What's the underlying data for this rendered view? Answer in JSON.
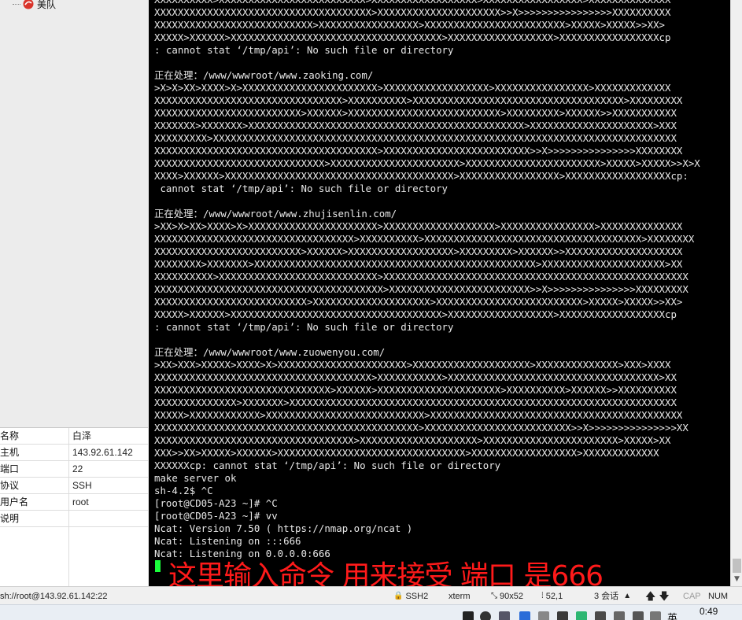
{
  "sidebar": {
    "tree_item_label": "美队",
    "properties": [
      {
        "key": "名称",
        "value": "白泽"
      },
      {
        "key": "主机",
        "value": "143.92.61.142"
      },
      {
        "key": "端口",
        "value": "22"
      },
      {
        "key": "协议",
        "value": "SSH"
      },
      {
        "key": "用户名",
        "value": "root"
      },
      {
        "key": "说明",
        "value": ""
      }
    ]
  },
  "terminal": {
    "lines": [
      "XXXXXXXXXX>XXXXXXXXXXXXXXXXXXXXXXXXX>XXXXXXXXXXXXXXXXXX>XXXXXXXXXXXXXXXXX>XXXXXXXXXXXXXX",
      "XXXXXXXXXXXXXXXXXXXXXXXXXXXXXXXXXXXXX>XXXXXXXXXXXXXXXXXXXXX>>X>>>>>>>>>>>>>>>>XXXXXXXXXX",
      "XXXXXXXXXXXXXXXXXXXXXXXXXXX>XXXXXXXXXXXXXXXXX>XXXXXXXXXXXXXXXXXXXXXXXX>XXXXX>XXXXX>>XX>",
      "XXXXX>XXXXXX>XXXXXXXXXXXXXXXXXXXXXXXXXXXXXXXXXXXX>XXXXXXXXXXXXXXXXXX>XXXXXXXXXXXXXXXXXcp",
      ": cannot stat ‘/tmp/api’: No such file or directory",
      "",
      "正在处理：/www/wwwroot/www.zaoking.com/",
      ">X>X>XX>XXXX>X>XXXXXXXXXXXXXXXXXXXXXXX>XXXXXXXXXXXXXXXXXX>XXXXXXXXXXXXXXXX>XXXXXXXXXXXXX",
      "XXXXXXXXXXXXXXXXXXXXXXXXXXXXXXXX>XXXXXXXXXX>XXXXXXXXXXXXXXXXXXXXXXXXXXXXXXXXXXXX>XXXXXXXXX",
      "XXXXXXXXXXXXXXXXXXXXXXXXX>XXXXXX>XXXXXXXXXXXXXXXXXXXXXXXXXX>XXXXXXXXX>XXXXXX>>XXXXXXXXXXX",
      "XXXXXXX>XXXXXXX>XXXXXXXXXXXXXXXXXXXXXXXXXXXXXXXXXXXXXXXXXXXXXXX>XXXXXXXXXXXXXXXXXXXXX>XXX",
      "XXXXXXXXX>XXXXXXXXXXXXXXXXXXXXXXXXXXXXXXXXXXXXXXXXXXXXXXXXXXXXXXXXXXXXXXXXXXXXXXXXXXXXXXX",
      "XXXXXXXXXXXXXXXXXXXXXXXXXXXXXXXXXXXXXX>XXXXXXXXXXXXXXXXXXXXXXXXX>>X>>>>>>>>>>>>>>>XXXXXXXX",
      "XXXXXXXXXXXXXXXXXXXXXXXXXXXXX>XXXXXXXXXXXXXXXXXXXXXX>XXXXXXXXXXXXXXXXXXXXXXX>XXXXX>XXXXX>>X>X",
      "XXXX>XXXXXX>XXXXXXXXXXXXXXXXXXXXXXXXXXXXXXXXXXXXXXX>XXXXXXXXXXXXXXXXX>XXXXXXXXXXXXXXXXXXcp:",
      " cannot stat ‘/tmp/api’: No such file or directory",
      "",
      "正在处理：/www/wwwroot/www.zhujisenlin.com/",
      ">XX>X>XX>XXXX>X>XXXXXXXXXXXXXXXXXXXXXX>XXXXXXXXXXXXXXXXXXX>XXXXXXXXXXXXXXXX>XXXXXXXXXXXXXX",
      "XXXXXXXXXXXXXXXXXXXXXXXXXXXXXXXXXX>XXXXXXXXXX>XXXXXXXXXXXXXXXXXXXXXXXXXXXXXXXXXXXXX>XXXXXXXX",
      "XXXXXXXXXXXXXXXXXXXXXXXXX>XXXXXX>XXXXXXXXXXXXXXXXXX>XXXXXXXXX>XXXXXX>>XXXXXXXXXXXXXXXXXXXX",
      "XXXXXXXX>XXXXXXX>XXXXXXXXXXXXXXXXXXXXXXXXXXXXXXXXXXXXXXXXXXXXXXXX>XXXXXXXXXXXXXXXXXXXXX>XX",
      "XXXXXXXXXX>XXXXXXXXXXXXXXXXXXXXXXXXXXX>XXXXXXXXXXXXXXXXXXXXXXXXXXXXXXXXXXXXXXXXXXXXXXXXXXXX",
      "XXXXXXXXXXXXXXXXXXXXXXXXXXXXXXXXXXXXXXX>XXXXXXXXXXXXXXXXXXXXXXXX>>X>>>>>>>>>>>>>>>XXXXXXXXX",
      "XXXXXXXXXXXXXXXXXXXXXXXXXX>XXXXXXXXXXXXXXXXXXXX>XXXXXXXXXXXXXXXXXXXXXXXXX>XXXXX>XXXXX>>XX>",
      "XXXXX>XXXXXX>XXXXXXXXXXXXXXXXXXXXXXXXXXXXXXXXXXXX>XXXXXXXXXXXXXXXXXX>XXXXXXXXXXXXXXXXXXcp",
      ": cannot stat ‘/tmp/api’: No such file or directory",
      "",
      "正在处理：/www/wwwroot/www.zuowenyou.com/",
      ">XX>XXX>XXXXX>XXXX>X>XXXXXXXXXXXXXXXXXXXXXX>XXXXXXXXXXXXXXXXXXXX>XXXXXXXXXXXXXX>XXX>XXXX",
      "XXXXXXXXXXXXXXXXXXXXXXXXXXXXXXXXXXXXX>XXXXXXXXXXX>XXXXXXXXXXXXXXXXXXXXXXXXXXXXXXXXXXXX>XX",
      "XXXXXXXXXXXXXXXXXXXXXXXXXXXXXX>XXXXXX>XXXXXXXXXXXXXXXXXXXXX>XXXXXXXXXX>XXXXXX>>XXXXXXXXXX",
      "XXXXXXXXXXXXXX>XXXXXXX>XXXXXXXXXXXXXXXXXXXXXXXXXXXXXXXXXXXXXXXXXXXXXXXXXXXXXXXXXXXXXXXXXX",
      "XXXXX>XXXXXXXXXXXX>XXXXXXXXXXXXXXXXXXXXXXXXXXX>XXXXXXXXXXXXXXXXXXXXXXXXXXXXXXXXXXXXXXXXXXX",
      "XXXXXXXXXXXXXXXXXXXXXXXXXXXXXXXXXXXXXXXXXXXXX>XXXXXXXXXXXXXXXXXXXXXXXXX>>X>>>>>>>>>>>>>>>XX",
      "XXXXXXXXXXXXXXXXXXXXXXXXXXXXXXXXXX>XXXXXXXXXXXXXXXXXXXX>XXXXXXXXXXXXXXXXXXXXXXX>XXXXX>XX",
      "XXX>>XX>XXXXX>XXXXXX>XXXXXXXXXXXXXXXXXXXXXXXXXXXXXXXX>XXXXXXXXXXXXXXXXXX>XXXXXXXXXXXXX",
      "XXXXXXcp: cannot stat ‘/tmp/api’: No such file or directory",
      "make server ok",
      "sh-4.2$ ^C",
      "[root@CD05-A23 ~]# ^C",
      "[root@CD05-A23 ~]# vv",
      "Ncat: Version 7.50 ( https://nmap.org/ncat )",
      "Ncat: Listening on :::666",
      "Ncat: Listening on 0.0.0.0:666"
    ],
    "annotation": "这里输入命令 用来接受  端口 是666",
    "cursor_color": "#1aff3c",
    "annotation_color": "#ff1a1a"
  },
  "statusbar": {
    "connection": "sh://root@143.92.61.142:22",
    "protocol": "SSH2",
    "terminal_type": "xterm",
    "size": "90x52",
    "position": "52,1",
    "sessions": "3 会话",
    "caps": "CAP",
    "num": "NUM"
  },
  "taskbar": {
    "clock": "0:49",
    "lang": "英"
  }
}
